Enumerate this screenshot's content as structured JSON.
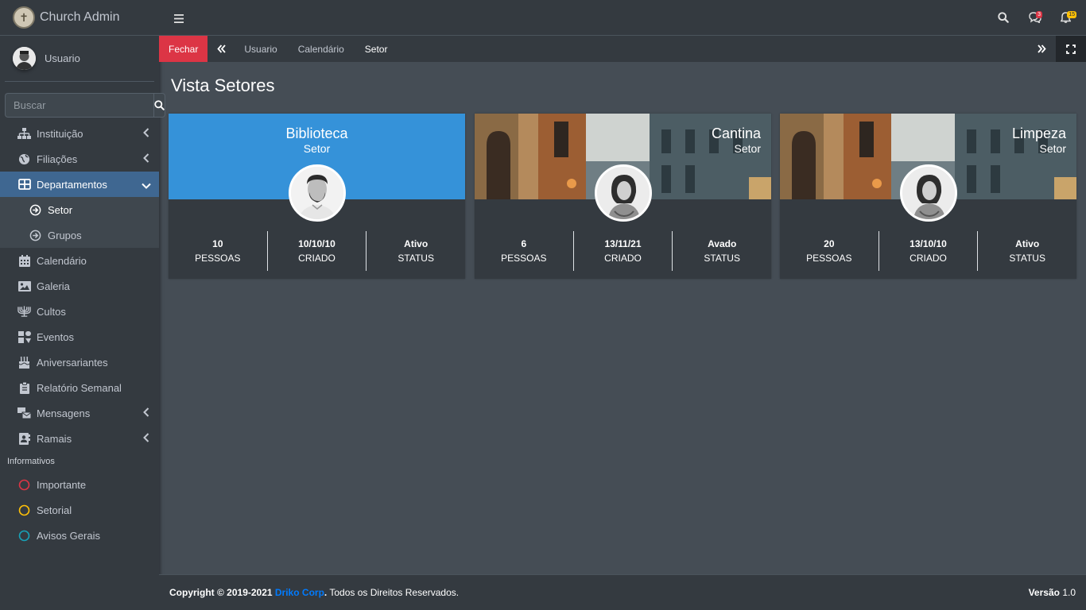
{
  "brand": {
    "name": "Church Admin"
  },
  "user": {
    "name": "Usuario"
  },
  "search": {
    "placeholder": "Buscar"
  },
  "sidebar": {
    "items": [
      {
        "label": "Instituição",
        "icon": "sitemap-icon"
      },
      {
        "label": "Filiações",
        "icon": "globe-icon"
      },
      {
        "label": "Departamentos",
        "icon": "table-icon"
      },
      {
        "label": "Setor",
        "icon": "arrow-circle-icon"
      },
      {
        "label": "Grupos",
        "icon": "arrow-circle-icon"
      },
      {
        "label": "Calendário",
        "icon": "calendar-icon"
      },
      {
        "label": "Galeria",
        "icon": "image-icon"
      },
      {
        "label": "Cultos",
        "icon": "menorah-icon"
      },
      {
        "label": "Eventos",
        "icon": "puzzle-icon"
      },
      {
        "label": "Aniversariantes",
        "icon": "birthday-cake-icon"
      },
      {
        "label": "Relatório Semanal",
        "icon": "clipboard-icon"
      },
      {
        "label": "Mensagens",
        "icon": "mail-bulk-icon"
      },
      {
        "label": "Ramais",
        "icon": "address-book-icon"
      }
    ],
    "header": "Informativos",
    "info": [
      {
        "label": "Importante",
        "color": "#dc3545"
      },
      {
        "label": "Setorial",
        "color": "#ffc107"
      },
      {
        "label": "Avisos Gerais",
        "color": "#17a2b8"
      }
    ]
  },
  "topbar": {
    "messages_badge": "3",
    "notifications_badge": "15"
  },
  "tabs": {
    "close": "Fechar",
    "items": [
      "Usuario",
      "Calendário",
      "Setor"
    ]
  },
  "page": {
    "title": "Vista Setores"
  },
  "cards": [
    {
      "name": "Biblioteca",
      "desc": "Setor",
      "stats": [
        {
          "value": "10",
          "label": "PESSOAS"
        },
        {
          "value": "10/10/10",
          "label": "CRIADO"
        },
        {
          "value": "Ativo",
          "label": "STATUS"
        }
      ]
    },
    {
      "name": "Cantina",
      "desc": "Setor",
      "stats": [
        {
          "value": "6",
          "label": "PESSOAS"
        },
        {
          "value": "13/11/21",
          "label": "CRIADO"
        },
        {
          "value": "Avado",
          "label": "STATUS"
        }
      ]
    },
    {
      "name": "Limpeza",
      "desc": "Setor",
      "stats": [
        {
          "value": "20",
          "label": "PESSOAS"
        },
        {
          "value": "13/10/10",
          "label": "CRIADO"
        },
        {
          "value": "Ativo",
          "label": "STATUS"
        }
      ]
    }
  ],
  "footer": {
    "copyright": "Copyright © 2019-2021 ",
    "company": "Driko Corp",
    "rights": ". Todos os Direitos Reservados.",
    "version_label": "Versão",
    "version": "1.0"
  }
}
